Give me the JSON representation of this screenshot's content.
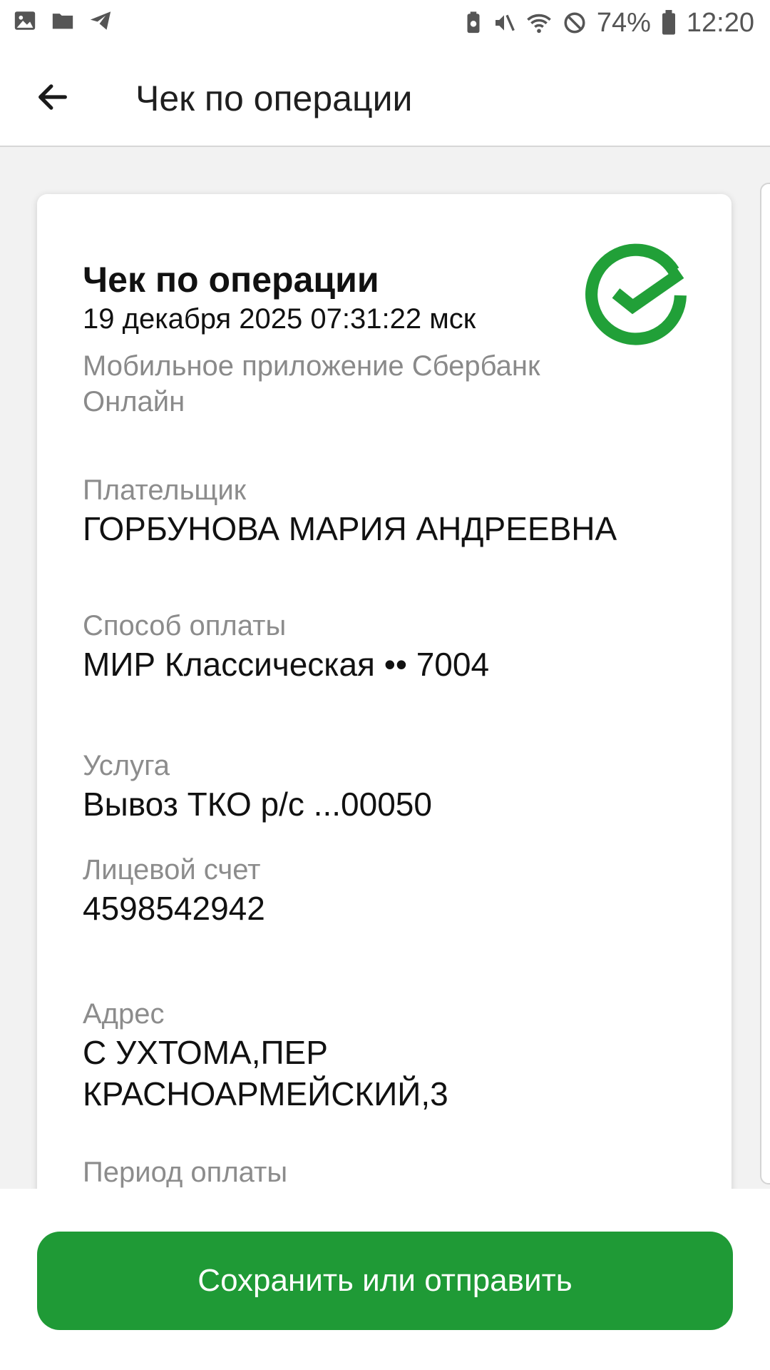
{
  "status_bar": {
    "battery": "74%",
    "time": "12:20",
    "icons": [
      "image-icon",
      "folder-icon",
      "telegram-icon",
      "battery-saver-icon",
      "mute-icon",
      "wifi-icon",
      "no-disturb-icon",
      "battery-icon"
    ]
  },
  "header": {
    "title": "Чек по операции"
  },
  "receipt": {
    "title": "Чек по операции",
    "date": "19 декабря 2025 07:31:22 мск",
    "source": "Мобильное приложение Сбербанк Онлайн",
    "fields": [
      {
        "label": "Плательщик",
        "value": "ГОРБУНОВА МАРИЯ АНДРЕЕВНА"
      },
      {
        "label": "Способ оплаты",
        "value": "МИР Классическая •• 7004"
      },
      {
        "label": "Услуга",
        "value": "Вывоз ТКО р/с ...00050"
      },
      {
        "label": "Лицевой счет",
        "value": "4598542942"
      },
      {
        "label": "Адрес",
        "value": "С УХТОМА,ПЕР КРАСНОАРМЕЙСКИЙ,3"
      },
      {
        "label": "Период оплаты",
        "value": ""
      }
    ]
  },
  "colors": {
    "accent": "#1f9a36"
  },
  "actions": {
    "save_label": "Сохранить или отправить"
  }
}
